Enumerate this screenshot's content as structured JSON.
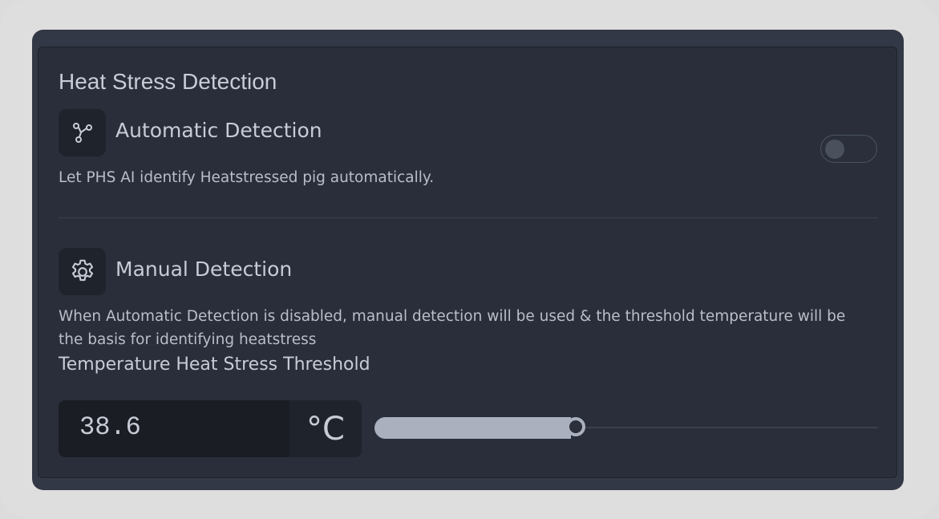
{
  "heading": "Heat Stress Detection",
  "automatic": {
    "icon": "graph-nodes-icon",
    "title": "Automatic Detection",
    "description": "Let PHS AI identify Heatstressed pig automatically.",
    "enabled": false
  },
  "manual": {
    "icon": "gear-icon",
    "title": "Manual Detection",
    "description": "When Automatic Detection is disabled, manual detection will be used & the threshold temperature will be the basis for identifying heatstress",
    "threshold_label": "Temperature Heat Stress Threshold",
    "threshold_value": "38.6",
    "unit": "°C",
    "slider_fraction": 0.39
  },
  "colors": {
    "panel": "#292e3a",
    "accent": "#aab0bd"
  }
}
